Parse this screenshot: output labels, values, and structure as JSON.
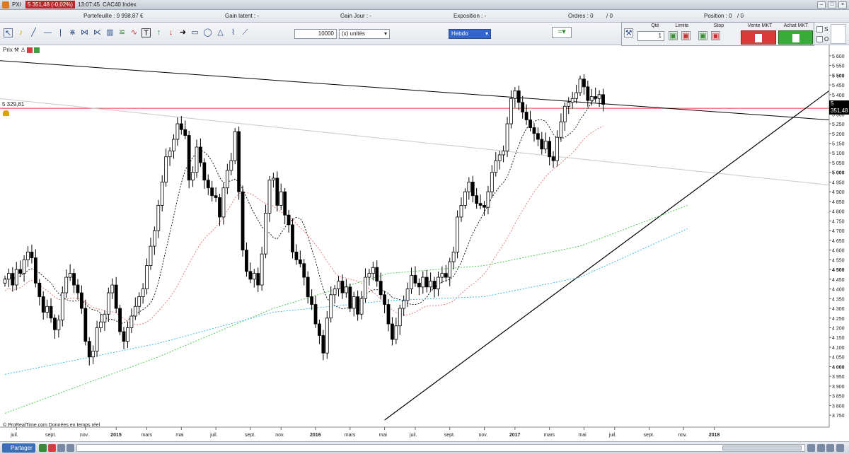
{
  "window": {
    "symbol": "PXI",
    "price": "5 351,48 (-0,02%)",
    "time": "13:07:45",
    "index": "CAC40 Index"
  },
  "info": {
    "portfolio": "Portefeuille : 9 998,87 €",
    "gain_latent": "Gain latent : -",
    "gain_jour": "Gain Jour : -",
    "exposition": "Exposition : -",
    "ordres": "Ordres : 0",
    "ordres_b": "/ 0",
    "position": "Position : 0",
    "position_b": "/ 0"
  },
  "toolbar": {
    "quantity": "10000",
    "unit": "(x) unités",
    "period": "Hebdo",
    "qty_label": "Qté",
    "qty_value": "1",
    "limit_label": "Limite",
    "stop_label": "Stop",
    "sell_label": "Vente MKT",
    "buy_label": "Achat MKT",
    "s_label": "S",
    "o_label": "O"
  },
  "chart_header": {
    "label": "Prix"
  },
  "bottom": {
    "share_label": "Partager",
    "source": "© ProRealTime.com  Données en temps réel"
  },
  "colors": {
    "candle": "#000000",
    "ma_black": "#000000",
    "ma_red": "#e07070",
    "ma_green": "#3fc63f",
    "ma_cyan": "#2ab8e8",
    "level_line": "#e04040",
    "trend_line": "#000000",
    "grey_line": "#c8c8c8"
  },
  "chart_data": {
    "type": "candlestick",
    "ylim": [
      3725,
      5625
    ],
    "yticks": [
      3750,
      3800,
      3850,
      3900,
      3950,
      4000,
      4050,
      4100,
      4150,
      4200,
      4250,
      4300,
      4350,
      4400,
      4450,
      4500,
      4550,
      4600,
      4650,
      4700,
      4750,
      4800,
      4850,
      4900,
      4950,
      5000,
      5050,
      5100,
      5150,
      5200,
      5250,
      5300,
      5350,
      5400,
      5450,
      5500,
      5550,
      5600
    ],
    "ytick_labels": [
      "3 750",
      "3 800",
      "3 850",
      "3 900",
      "3 950",
      "4 000",
      "4 050",
      "4 100",
      "4 150",
      "4 200",
      "4 250",
      "4 300",
      "4 350",
      "4 400",
      "4 450",
      "4 500",
      "4 550",
      "4 600",
      "4 650",
      "4 700",
      "4 750",
      "4 800",
      "4 850",
      "4 900",
      "4 950",
      "5 000",
      "5 050",
      "5 100",
      "5 150",
      "5 200",
      "5 250",
      "5 300",
      "5 350",
      "5 400",
      "5 450",
      "5 500",
      "5 550",
      "5 600"
    ],
    "bold_ticks": [
      4000,
      4500,
      5000,
      5500
    ],
    "xticks": [
      {
        "i": 3,
        "label": "juil."
      },
      {
        "i": 12,
        "label": "sept."
      },
      {
        "i": 21,
        "label": "nov."
      },
      {
        "i": 29,
        "label": "2015"
      },
      {
        "i": 37,
        "label": "mars"
      },
      {
        "i": 46,
        "label": "mai"
      },
      {
        "i": 55,
        "label": "juil."
      },
      {
        "i": 64,
        "label": "sept."
      },
      {
        "i": 72,
        "label": "nov."
      },
      {
        "i": 81,
        "label": "2016"
      },
      {
        "i": 90,
        "label": "mars"
      },
      {
        "i": 99,
        "label": "mai"
      },
      {
        "i": 107,
        "label": "juil."
      },
      {
        "i": 116,
        "label": "sept."
      },
      {
        "i": 125,
        "label": "nov."
      },
      {
        "i": 133,
        "label": "2017"
      },
      {
        "i": 142,
        "label": "mars"
      },
      {
        "i": 151,
        "label": "mai"
      },
      {
        "i": 159,
        "label": "juil."
      },
      {
        "i": 168,
        "label": "sept."
      },
      {
        "i": 177,
        "label": "nov."
      },
      {
        "i": 185,
        "label": "2018"
      }
    ],
    "level_value": 5329.81,
    "level_label": "5 329,81",
    "current_price_label": "5 351,48",
    "closes": [
      4450,
      4480,
      4420,
      4500,
      4480,
      4550,
      4590,
      4560,
      4430,
      4360,
      4280,
      4310,
      4250,
      4190,
      4240,
      4380,
      4460,
      4480,
      4420,
      4380,
      4300,
      4130,
      4050,
      4080,
      4200,
      4230,
      4270,
      4380,
      4420,
      4300,
      4180,
      4130,
      4200,
      4260,
      4310,
      4360,
      4400,
      4520,
      4620,
      4700,
      4830,
      4950,
      5080,
      5110,
      5170,
      5250,
      5220,
      5190,
      4960,
      5000,
      5130,
      5050,
      4960,
      4920,
      4880,
      4870,
      4770,
      4920,
      5010,
      5060,
      5210,
      4900,
      4600,
      4490,
      4450,
      4480,
      4420,
      4580,
      4790,
      4960,
      4970,
      4830,
      4900,
      4780,
      4730,
      4590,
      4550,
      4530,
      4460,
      4360,
      4320,
      4220,
      4160,
      4070,
      4250,
      4370,
      4400,
      4440,
      4380,
      4410,
      4300,
      4360,
      4270,
      4350,
      4460,
      4480,
      4510,
      4440,
      4370,
      4320,
      4220,
      4140,
      4210,
      4300,
      4340,
      4400,
      4470,
      4430,
      4410,
      4460,
      4410,
      4440,
      4400,
      4460,
      4480,
      4460,
      4540,
      4590,
      4770,
      4830,
      4900,
      4950,
      4880,
      4840,
      4830,
      4820,
      4900,
      5000,
      5060,
      5090,
      5110,
      5250,
      5380,
      5420,
      5360,
      5310,
      5270,
      5230,
      5200,
      5170,
      5120,
      5160,
      5080,
      5060,
      5180,
      5260,
      5340,
      5360,
      5380,
      5410,
      5480,
      5440,
      5370,
      5390,
      5380,
      5400,
      5350
    ],
    "series": [
      {
        "name": "MA short",
        "color": "black"
      },
      {
        "name": "MA medium",
        "color": "red"
      },
      {
        "name": "MA long",
        "color": "green"
      },
      {
        "name": "MA very long",
        "color": "cyan"
      }
    ]
  }
}
